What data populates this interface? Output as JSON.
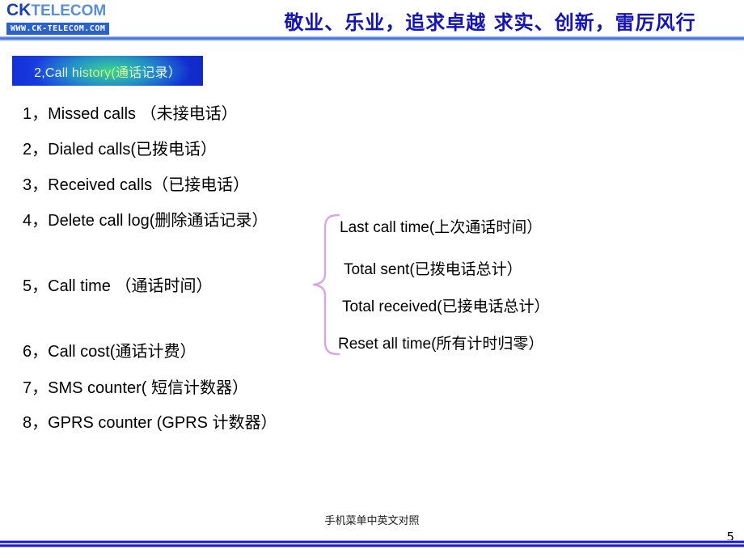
{
  "header": {
    "logo": {
      "brand_bold": "CK",
      "brand_light": "TELECOM",
      "url": "WWW.CK-TELECOM.COM"
    },
    "slogan": "敬业、乐业，追求卓越    求实、创新，雷厉风行"
  },
  "section": {
    "title": "2,Call history(通话记录）",
    "accent_color": "#1a3ce4",
    "accent_color_2": "#3cdc8c"
  },
  "menu": {
    "items": [
      "1，Missed calls （未接电话）",
      "2，Dialed calls(已拨电话）",
      "3，Received calls（已接电话）",
      "4，Delete call log(删除通话记录）",
      "5，Call time （通话时间）",
      "6，Call cost(通话计费）",
      "7，SMS counter( 短信计数器）",
      "8，GPRS counter (GPRS 计数器）"
    ]
  },
  "sub_menu": {
    "brace_color": "#d7a6e2",
    "items": [
      "Last call time(上次通话时间）",
      "Total sent(已拨电话总计）",
      "Total received(已接电话总计）",
      "Reset all time(所有计时归零）"
    ]
  },
  "footer": {
    "caption": "手机菜单中英文对照",
    "page_number": "5",
    "rule_color": "#1a18c8"
  }
}
